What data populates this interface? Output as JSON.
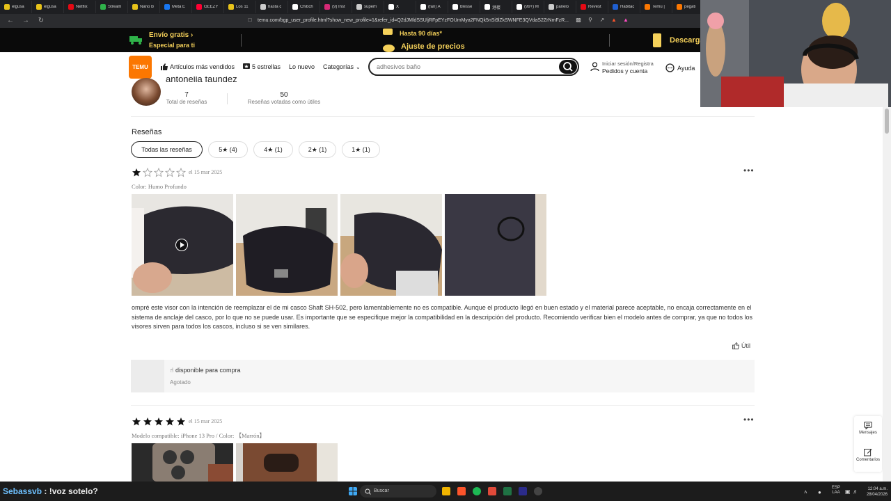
{
  "browser": {
    "tabs": [
      {
        "label": "elgusa",
        "color": "#e8c31a"
      },
      {
        "label": "elgusa",
        "color": "#e8c31a"
      },
      {
        "label": "Netflix",
        "color": "#e50914"
      },
      {
        "label": "Stream",
        "color": "#2fb34a"
      },
      {
        "label": "Nano B",
        "color": "#e8c31a"
      },
      {
        "label": "Meta E",
        "color": "#1877f2"
      },
      {
        "label": "GEEZY",
        "color": "#ff0033"
      },
      {
        "label": "Los 11",
        "color": "#e8c31a"
      },
      {
        "label": "hasta c",
        "color": "#cccccc"
      },
      {
        "label": "Chibch",
        "color": "#ffffff"
      },
      {
        "label": "(9) Inst",
        "color": "#d62976"
      },
      {
        "label": "superfi",
        "color": "#cccccc"
      },
      {
        "label": "X",
        "color": "#ffffff"
      },
      {
        "label": "(fan) A",
        "color": "#ffffff"
      },
      {
        "label": "blesse",
        "color": "#ffffff"
      },
      {
        "label": "港楼",
        "color": "#ffffff"
      },
      {
        "label": "(99+) M",
        "color": "#ffffff"
      },
      {
        "label": "panelo",
        "color": "#cccccc"
      },
      {
        "label": "Revest",
        "color": "#e50914"
      },
      {
        "label": "Habitac",
        "color": "#1f5fd1"
      },
      {
        "label": "Temu |",
        "color": "#fb7701"
      },
      {
        "label": "pegati",
        "color": "#fb7701"
      }
    ],
    "url": "temu.com/bgp_user_profile.html?show_new_profile=1&refer_id=Q2dJMldSSUljRFpEYzFOUmMya2FNQk5nSi9lZkSWNFE3QVdaS2ZrNmFzR..."
  },
  "promo": {
    "free_shipping": "Envío gratis",
    "special": "Especial para ti",
    "days": "Hasta 90 días*",
    "price_adjust": "Ajuste de precios",
    "download": "Descarga"
  },
  "header": {
    "logo": "TEMU",
    "nav": {
      "bestsellers": "Artículos más vendidos",
      "five_stars": "5 estrellas",
      "new": "Lo nuevo",
      "categories": "Categorías"
    },
    "search_placeholder": "adhesivos baño",
    "account_line1": "Iniciar sesión/Registra",
    "account_line2": "Pedidos y cuenta",
    "help": "Ayuda"
  },
  "profile": {
    "name": "antonella faundez",
    "total_reviews": "7",
    "total_reviews_label": "Total de reseñas",
    "useful_votes": "50",
    "useful_votes_label": "Reseñas votadas como útiles"
  },
  "reviews": {
    "title": "Reseñas",
    "filters": [
      "Todas las reseñas",
      "5★ (4)",
      "4★ (1)",
      "2★ (1)",
      "1★ (1)"
    ],
    "items": [
      {
        "rating": 1,
        "date": "el 15 mar 2025",
        "meta": "Color: Humo Profundo",
        "text": "ompré este visor con la intención de reemplazar el de mi casco Shaft SH-502, pero lamentablemente no es compatible. Aunque el producto llegó en buen estado y el material parece aceptable, no encaja correctamente en el sistema de anclaje del casco, por lo que no se puede usar. Es importante que se especifique mejor la compatibilidad en la descripción del producto. Recomiendo verificar bien el modelo antes de comprar, ya que no todos los visores sirven para todos los cascos, incluso si se ven similares.",
        "useful": "Útil",
        "product_status": "disponible para compra",
        "product_stock": "Agotado"
      },
      {
        "rating": 5,
        "date": "el 15 mar 2025",
        "meta": "Modelo compatible: iPhone 13 Pro / Color: 【Marrón】"
      }
    ]
  },
  "float": {
    "messages": "Mensajes",
    "comments": "Comentarios"
  },
  "taskbar": {
    "stream_name": "Sebassvb",
    "stream_msg": ": !voz sotelo?",
    "search": "Buscar",
    "lang": "ESP",
    "lang2": "LAA",
    "time": "12:04 a.m.",
    "date": "28/04/2026"
  },
  "colors": {
    "brand": "#fb7701",
    "promo_text": "#f5d15a",
    "star": "#111111"
  }
}
